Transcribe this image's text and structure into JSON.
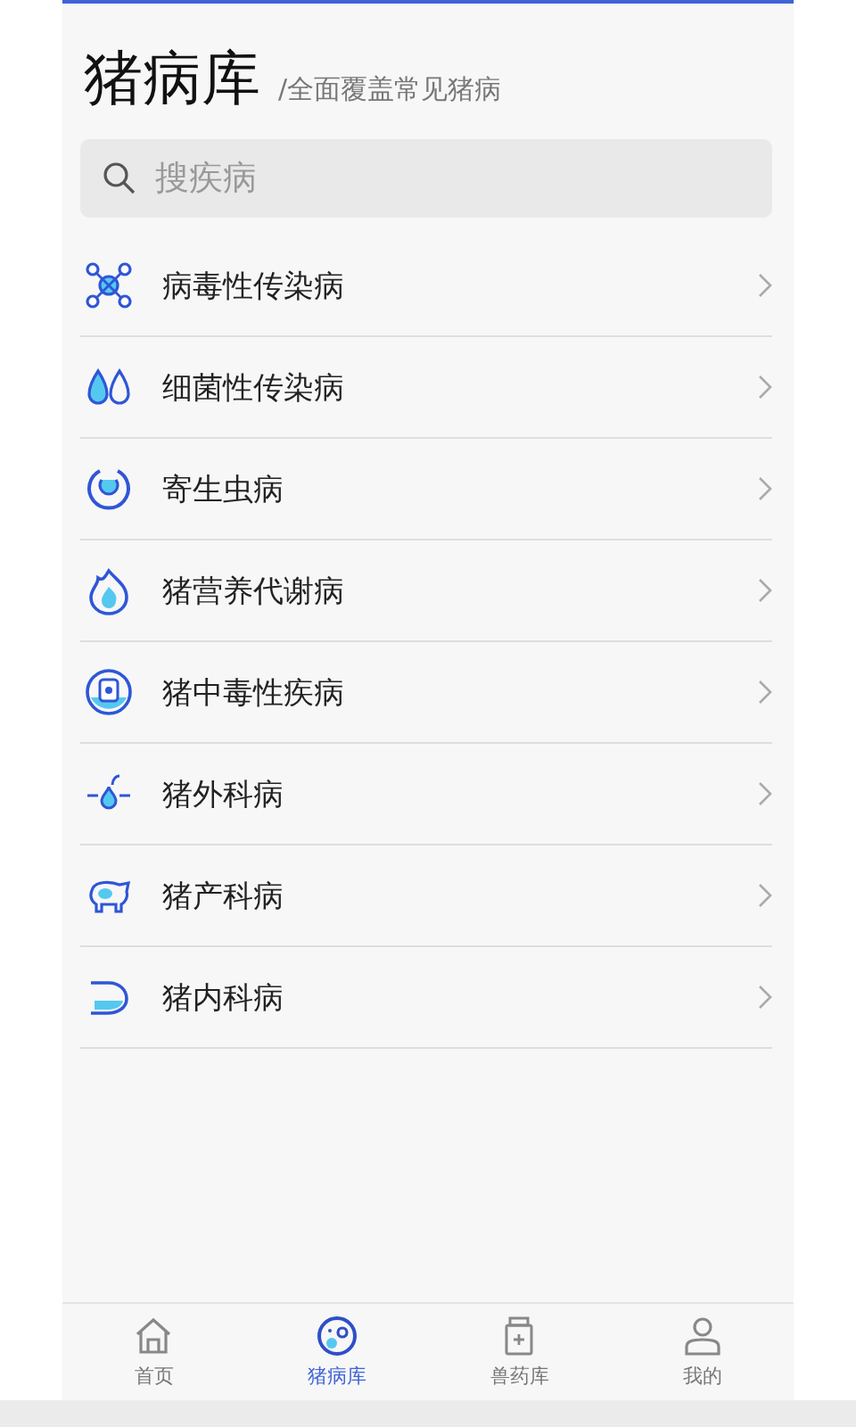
{
  "header": {
    "title": "猪病库",
    "subtitle": "/全面覆盖常见猪病"
  },
  "search": {
    "placeholder": "搜疾病"
  },
  "categories": [
    {
      "label": "病毒性传染病"
    },
    {
      "label": "细菌性传染病"
    },
    {
      "label": "寄生虫病"
    },
    {
      "label": "猪营养代谢病"
    },
    {
      "label": "猪中毒性疾病"
    },
    {
      "label": "猪外科病"
    },
    {
      "label": "猪产科病"
    },
    {
      "label": "猪内科病"
    }
  ],
  "tab_bar": [
    {
      "label": "首页",
      "selected": false
    },
    {
      "label": "猪病库",
      "selected": true
    },
    {
      "label": "兽药库",
      "selected": false
    },
    {
      "label": "我的",
      "selected": false
    }
  ]
}
